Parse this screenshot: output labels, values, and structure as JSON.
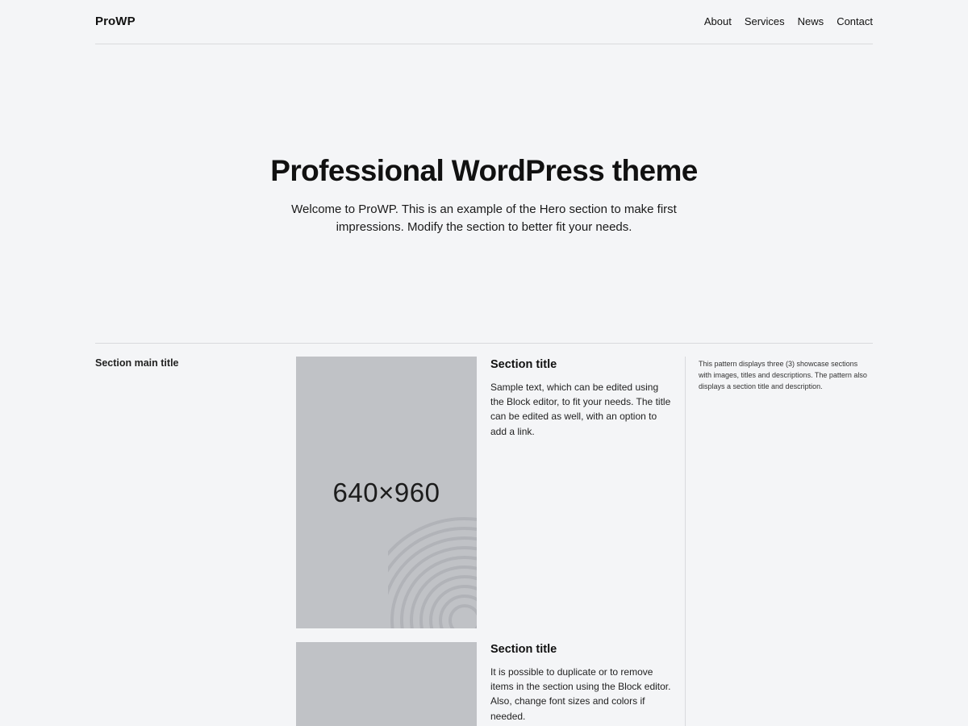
{
  "header": {
    "brand": "ProWP",
    "nav": [
      "About",
      "Services",
      "News",
      "Contact"
    ]
  },
  "hero": {
    "title": "Professional WordPress theme",
    "subtitle": "Welcome to ProWP. This is an example of the Hero section to make first impressions. Modify the section to better fit your needs."
  },
  "section": {
    "main_title": "Section main title",
    "description": "This pattern displays three (3) showcase sections with images, titles and descriptions. The pattern also displays a section title and description.",
    "items": [
      {
        "image_label": "640×960",
        "title": "Section title",
        "text": "Sample text, which can be edited using the Block editor, to fit your needs. The title can be edited as well, with an option to add a link."
      },
      {
        "image_label": "",
        "title": "Section title",
        "text": "It is possible to duplicate or to remove items in the section using the Block editor. Also, change font sizes and colors if needed."
      }
    ]
  },
  "colors": {
    "background": "#f4f5f7",
    "placeholder": "#c0c2c6",
    "divider": "#d9dadd",
    "text": "#111111"
  }
}
